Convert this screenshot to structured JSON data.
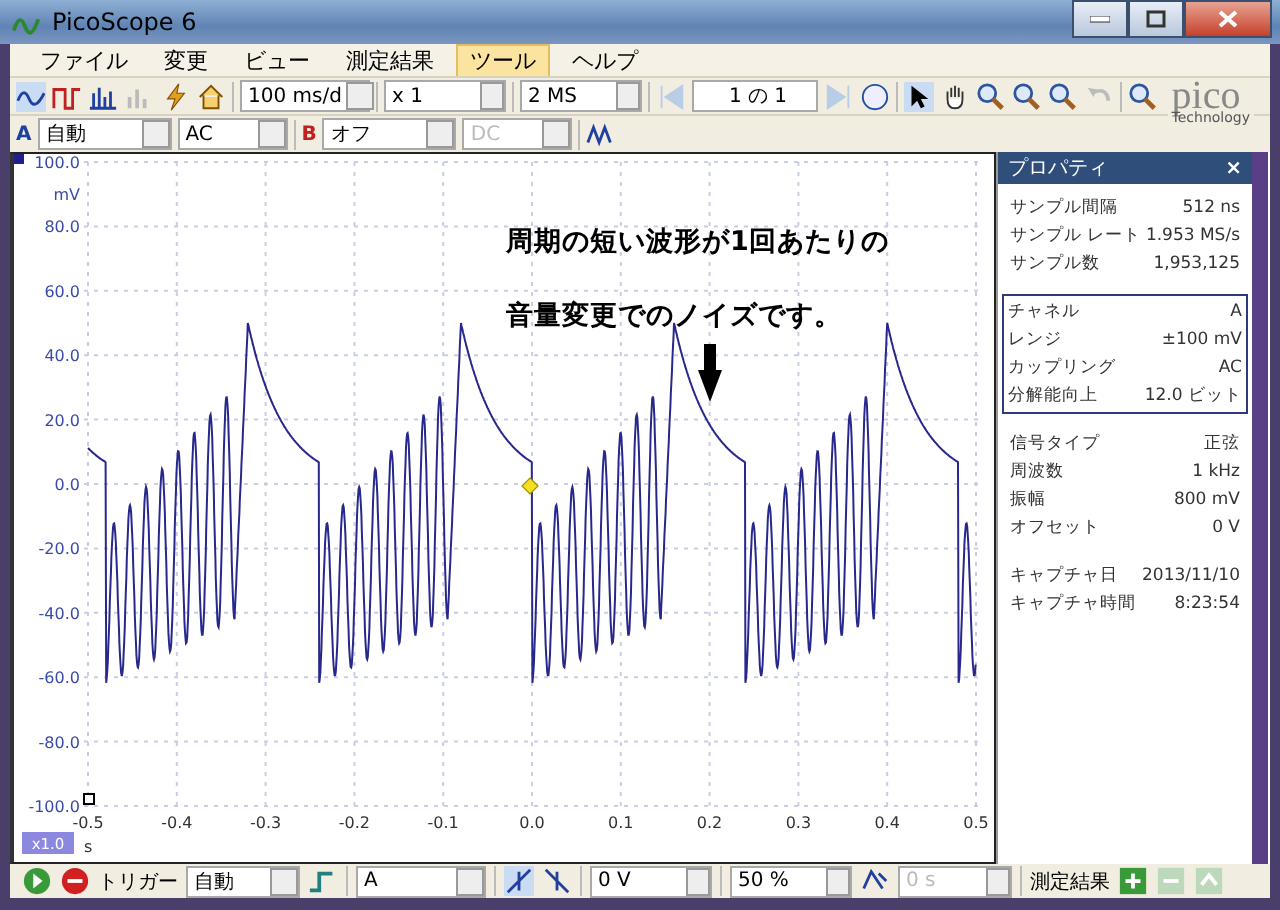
{
  "window": {
    "title": "PicoScope 6"
  },
  "menu": [
    {
      "label": "ファイル",
      "selected": false
    },
    {
      "label": "変更",
      "selected": false
    },
    {
      "label": "ビュー",
      "selected": false
    },
    {
      "label": "測定結果",
      "selected": false
    },
    {
      "label": "ツール",
      "selected": true
    },
    {
      "label": "ヘルプ",
      "selected": false
    }
  ],
  "logo": {
    "name": "pico",
    "tagline": "Technology"
  },
  "toolbar": {
    "timebase": "100 ms/d",
    "zoom": "x 1",
    "samples": "2 MS",
    "buffer": "1 の 1"
  },
  "channels": [
    {
      "letter": "A",
      "range": "自動",
      "coupling": "AC",
      "enabled": true
    },
    {
      "letter": "B",
      "range": "オフ",
      "coupling": "DC",
      "enabled": false
    }
  ],
  "graph": {
    "y_unit": "mV",
    "y_ticks": [
      "100.0",
      "80.0",
      "60.0",
      "40.0",
      "20.0",
      "0.0",
      "-20.0",
      "-40.0",
      "-60.0",
      "-80.0",
      "-100.0"
    ],
    "x_ticks": [
      "-0.5",
      "-0.4",
      "-0.3",
      "-0.2",
      "-0.1",
      "0.0",
      "0.1",
      "0.2",
      "0.3",
      "0.4",
      "0.5"
    ],
    "x_unit": "s",
    "zoom_badge": "x1.0",
    "annotation": [
      "周期の短い波形が1回あたりの",
      "音量変更でのノイズです。"
    ]
  },
  "properties": {
    "title": "プロパティ",
    "close": "×",
    "groups": [
      {
        "boxed": false,
        "rows": [
          {
            "label": "サンプル間隔",
            "value": "512 ns"
          },
          {
            "label": "サンプル レート",
            "value": "1.953 MS/s"
          },
          {
            "label": "サンプル数",
            "value": "1,953,125"
          }
        ]
      },
      {
        "boxed": true,
        "rows": [
          {
            "label": "チャネル",
            "value": "A"
          },
          {
            "label": "レンジ",
            "value": "±100 mV"
          },
          {
            "label": "カップリング",
            "value": "AC"
          },
          {
            "label": "分解能向上",
            "value": "12.0 ビット"
          }
        ]
      },
      {
        "boxed": false,
        "rows": [
          {
            "label": "信号タイプ",
            "value": "正弦"
          },
          {
            "label": "周波数",
            "value": "1 kHz"
          },
          {
            "label": "振幅",
            "value": "800 mV"
          },
          {
            "label": "オフセット",
            "value": "0 V"
          }
        ]
      },
      {
        "boxed": false,
        "rows": [
          {
            "label": "キャプチャ日",
            "value": "2013/11/10"
          },
          {
            "label": "キャプチャ時間",
            "value": "8:23:54"
          }
        ]
      }
    ]
  },
  "trigger": {
    "label": "トリガー",
    "mode": "自動",
    "source": "A",
    "threshold": "0 V",
    "pretrigger": "50 %",
    "delay": "0 s",
    "delay_disabled": true,
    "measurements_label": "測定結果"
  }
}
